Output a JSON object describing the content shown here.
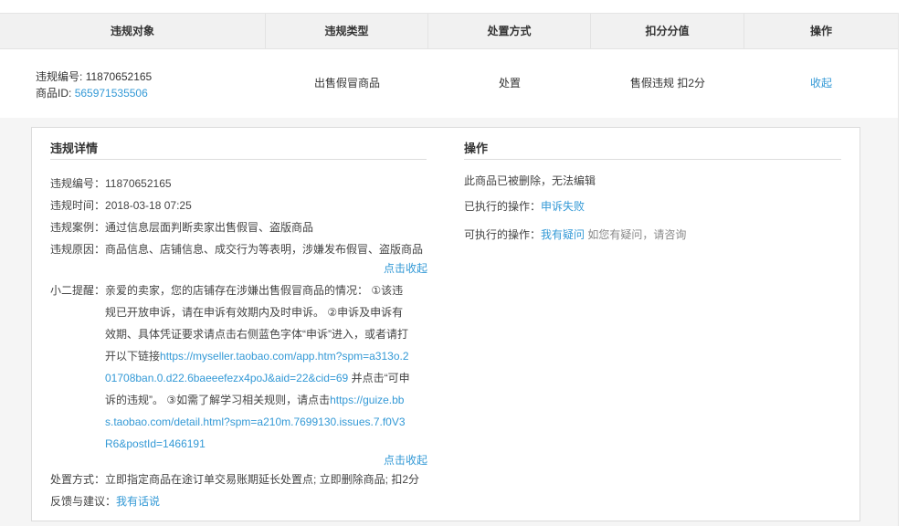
{
  "table": {
    "headers": [
      "违规对象",
      "违规类型",
      "处置方式",
      "扣分分值",
      "操作"
    ],
    "row": {
      "violation_no_label": "违规编号:",
      "violation_no": "11870652165",
      "item_id_label": "商品ID:",
      "item_id": "565971535506",
      "type": "出售假冒商品",
      "method": "处置",
      "points": "售假违规 扣2分",
      "action": "收起"
    }
  },
  "details": {
    "title": "违规详情",
    "no_label": "违规编号：",
    "no": "11870652165",
    "time_label": "违规时间：",
    "time": "2018-03-18 07:25",
    "case_label": "违规案例：",
    "case": "通过信息层面判断卖家出售假冒、盗版商品",
    "reason_label": "违规原因：",
    "reason": "商品信息、店铺信息、成交行为等表明，涉嫌发布假冒、盗版商品",
    "fold_1": "点击收起",
    "tip_label": "小二提醒：",
    "tip_part1": "亲爱的卖家，您的店铺存在涉嫌出售假冒商品的情况： ①该违规已开放申诉，请在申诉有效期内及时申诉。 ②申诉及申诉有效期、具体凭证要求请点击右侧蓝色字体“申诉”进入，或者请打开以下链接",
    "tip_link1": "https://myseller.taobao.com/app.htm?spm=a313o.201708ban.0.d22.6baeeefezx4poJ&aid=22&cid=69",
    "tip_part2": " 并点击“可申诉的违规”。 ③如需了解学习相关规则，请点击",
    "tip_link2": "https://guize.bbs.taobao.com/detail.html?spm=a210m.7699130.issues.7.f0V3R6&postId=1466191",
    "fold_2": "点击收起",
    "handling_label": "处置方式：",
    "handling": "立即指定商品在途订单交易账期延长处置点; 立即删除商品; 扣2分",
    "feedback_label": "反馈与建议：",
    "feedback_link": "我有话说"
  },
  "operations": {
    "title": "操作",
    "status": "此商品已被删除，无法编辑",
    "executed_label": "已执行的操作：",
    "executed_value": "申诉失败",
    "available_label": "可执行的操作：",
    "available_link": "我有疑问",
    "available_hint": "如您有疑问，请咨询"
  },
  "colors": {
    "link": "#3399d6",
    "header_bg": "#f1f1f1",
    "panel_bg": "#f5f5f5"
  }
}
